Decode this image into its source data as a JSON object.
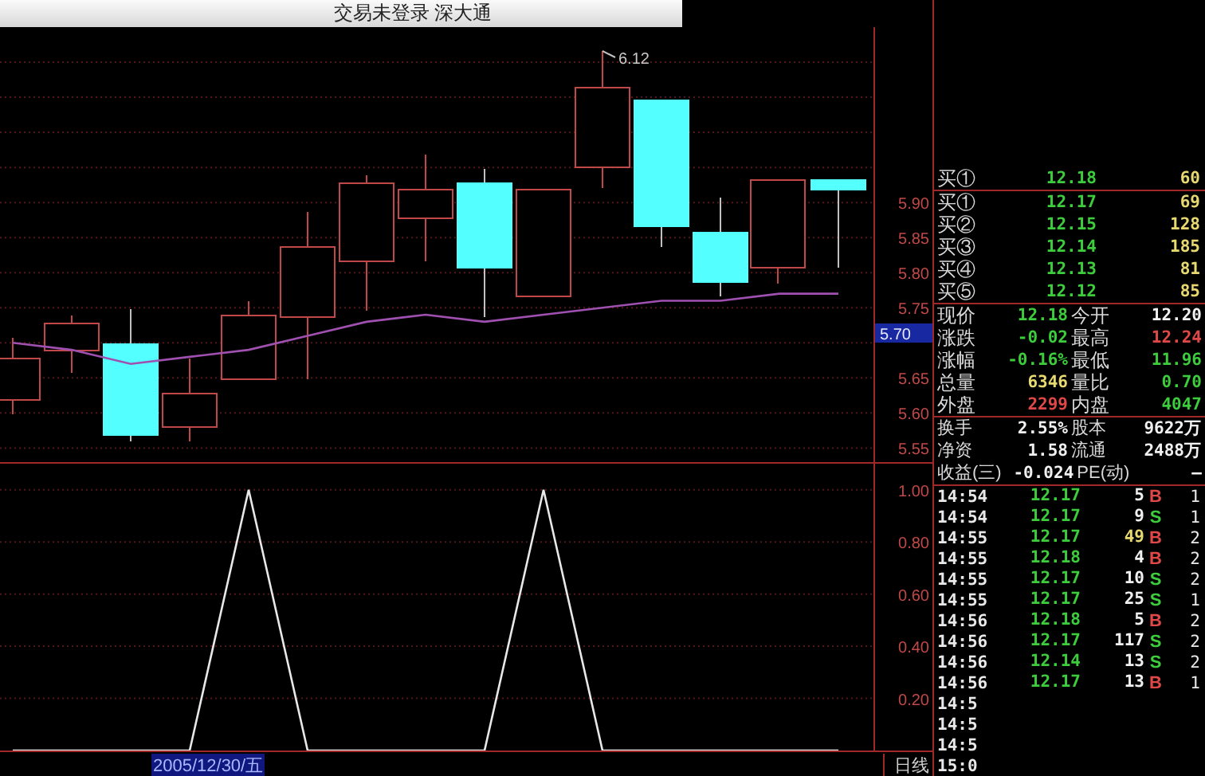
{
  "window": {
    "title": "交易未登录 深大通"
  },
  "price_chart": {
    "high_marker": "6.12",
    "current_label": "5.70",
    "chart_data": {
      "type": "line",
      "grid": true,
      "ylim": [
        5.53,
        6.15
      ],
      "series": [
        {
          "color": "#a050b0",
          "values": [
            5.7,
            5.69,
            5.67,
            5.68,
            5.69,
            5.71,
            5.73,
            5.74,
            5.73,
            5.74,
            5.75,
            5.76,
            5.76,
            5.77,
            5.77
          ]
        }
      ],
      "yticks": [
        {
          "value": 5.9,
          "label": "5.90"
        },
        {
          "value": 5.85,
          "label": "5.85"
        },
        {
          "value": 5.8,
          "label": "5.80"
        },
        {
          "value": 5.75,
          "label": "5.75"
        },
        {
          "value": 5.65,
          "label": "5.65"
        },
        {
          "value": 5.6,
          "label": "5.60"
        },
        {
          "value": 5.55,
          "label": "5.55"
        }
      ]
    }
  },
  "indicator_chart": {
    "chart_data": {
      "type": "line",
      "grid": true,
      "color": "#e8e8e8",
      "values": [
        0,
        0,
        0,
        0,
        1,
        0,
        0,
        0,
        0,
        1,
        0,
        0,
        0,
        0,
        0
      ],
      "ylim": [
        0,
        1.1
      ],
      "yticks": [
        {
          "value": 1,
          "label": "1.00"
        },
        {
          "value": 0.8,
          "label": "0.80"
        },
        {
          "value": 0.6,
          "label": "0.60"
        },
        {
          "value": 0.4,
          "label": "0.40"
        },
        {
          "value": 0.2,
          "label": "0.20"
        }
      ]
    }
  },
  "footer": {
    "date": "2005/12/30/五",
    "period": "日线"
  },
  "order_book": {
    "top_row": {
      "label": "买①",
      "price": "12.18",
      "volume": "60"
    },
    "bids": [
      {
        "label": "买①",
        "price": "12.17",
        "volume": "69"
      },
      {
        "label": "买②",
        "price": "12.15",
        "volume": "128"
      },
      {
        "label": "买③",
        "price": "12.14",
        "volume": "185"
      },
      {
        "label": "买④",
        "price": "12.13",
        "volume": "81"
      },
      {
        "label": "买⑤",
        "price": "12.12",
        "volume": "85"
      }
    ]
  },
  "quote": [
    [
      {
        "label": "现价",
        "value": "12.18",
        "color": "#3ccc3c"
      },
      {
        "label": "今开",
        "value": "12.20",
        "color": "#f0f0f0"
      }
    ],
    [
      {
        "label": "涨跌",
        "value": "-0.02",
        "color": "#3ccc3c"
      },
      {
        "label": "最高",
        "value": "12.24",
        "color": "#e04848"
      }
    ],
    [
      {
        "label": "涨幅",
        "value": "-0.16%",
        "color": "#3ccc3c"
      },
      {
        "label": "最低",
        "value": "11.96",
        "color": "#3ccc3c"
      }
    ],
    [
      {
        "label": "总量",
        "value": "6346",
        "color": "#e8d870"
      },
      {
        "label": "量比",
        "value": "0.70",
        "color": "#3ccc3c"
      }
    ],
    [
      {
        "label": "外盘",
        "value": "2299",
        "color": "#e04848"
      },
      {
        "label": "内盘",
        "value": "4047",
        "color": "#3ccc3c"
      }
    ]
  ],
  "fundamentals": [
    [
      {
        "label": "换手",
        "value": "2.55%"
      },
      {
        "label": "股本",
        "value": "9622万"
      }
    ],
    [
      {
        "label": "净资",
        "value": "1.58"
      },
      {
        "label": "流通",
        "value": "2488万"
      }
    ],
    [
      {
        "label": "收益(三)",
        "value": "-0.024"
      },
      {
        "label": "PE(动)",
        "value": "—"
      }
    ]
  ],
  "trades": [
    {
      "time": "14:54",
      "price": "12.17",
      "volume": {
        "text": "5",
        "color": "#f0f0f0"
      },
      "side": {
        "text": "B",
        "color": "#e04848"
      },
      "count": "1"
    },
    {
      "time": "14:54",
      "price": "12.17",
      "volume": {
        "text": "9",
        "color": "#f0f0f0"
      },
      "side": {
        "text": "S",
        "color": "#3ccc3c"
      },
      "count": "1"
    },
    {
      "time": "14:55",
      "price": "12.17",
      "volume": {
        "text": "49",
        "color": "#e8d870"
      },
      "side": {
        "text": "B",
        "color": "#e04848"
      },
      "count": "2"
    },
    {
      "time": "14:55",
      "price": "12.18",
      "volume": {
        "text": "4",
        "color": "#f0f0f0"
      },
      "side": {
        "text": "B",
        "color": "#e04848"
      },
      "count": "2"
    },
    {
      "time": "14:55",
      "price": "12.17",
      "volume": {
        "text": "10",
        "color": "#f0f0f0"
      },
      "side": {
        "text": "S",
        "color": "#3ccc3c"
      },
      "count": "2"
    },
    {
      "time": "14:55",
      "price": "12.17",
      "volume": {
        "text": "25",
        "color": "#f0f0f0"
      },
      "side": {
        "text": "S",
        "color": "#3ccc3c"
      },
      "count": "1"
    },
    {
      "time": "14:56",
      "price": "12.18",
      "volume": {
        "text": "5",
        "color": "#f0f0f0"
      },
      "side": {
        "text": "B",
        "color": "#e04848"
      },
      "count": "2"
    },
    {
      "time": "14:56",
      "price": "12.17",
      "volume": {
        "text": "117",
        "color": "#f0f0f0"
      },
      "side": {
        "text": "S",
        "color": "#3ccc3c"
      },
      "count": "2"
    },
    {
      "time": "14:56",
      "price": "12.14",
      "volume": {
        "text": "13",
        "color": "#f0f0f0"
      },
      "side": {
        "text": "S",
        "color": "#3ccc3c"
      },
      "count": "2"
    },
    {
      "time": "14:56",
      "price": "12.17",
      "volume": {
        "text": "13",
        "color": "#f0f0f0"
      },
      "side": {
        "text": "B",
        "color": "#e04848"
      },
      "count": "1"
    },
    {
      "time": "14:5"
    },
    {
      "time": "14:5"
    },
    {
      "time": "14:5"
    },
    {
      "time": "15:0"
    }
  ]
}
